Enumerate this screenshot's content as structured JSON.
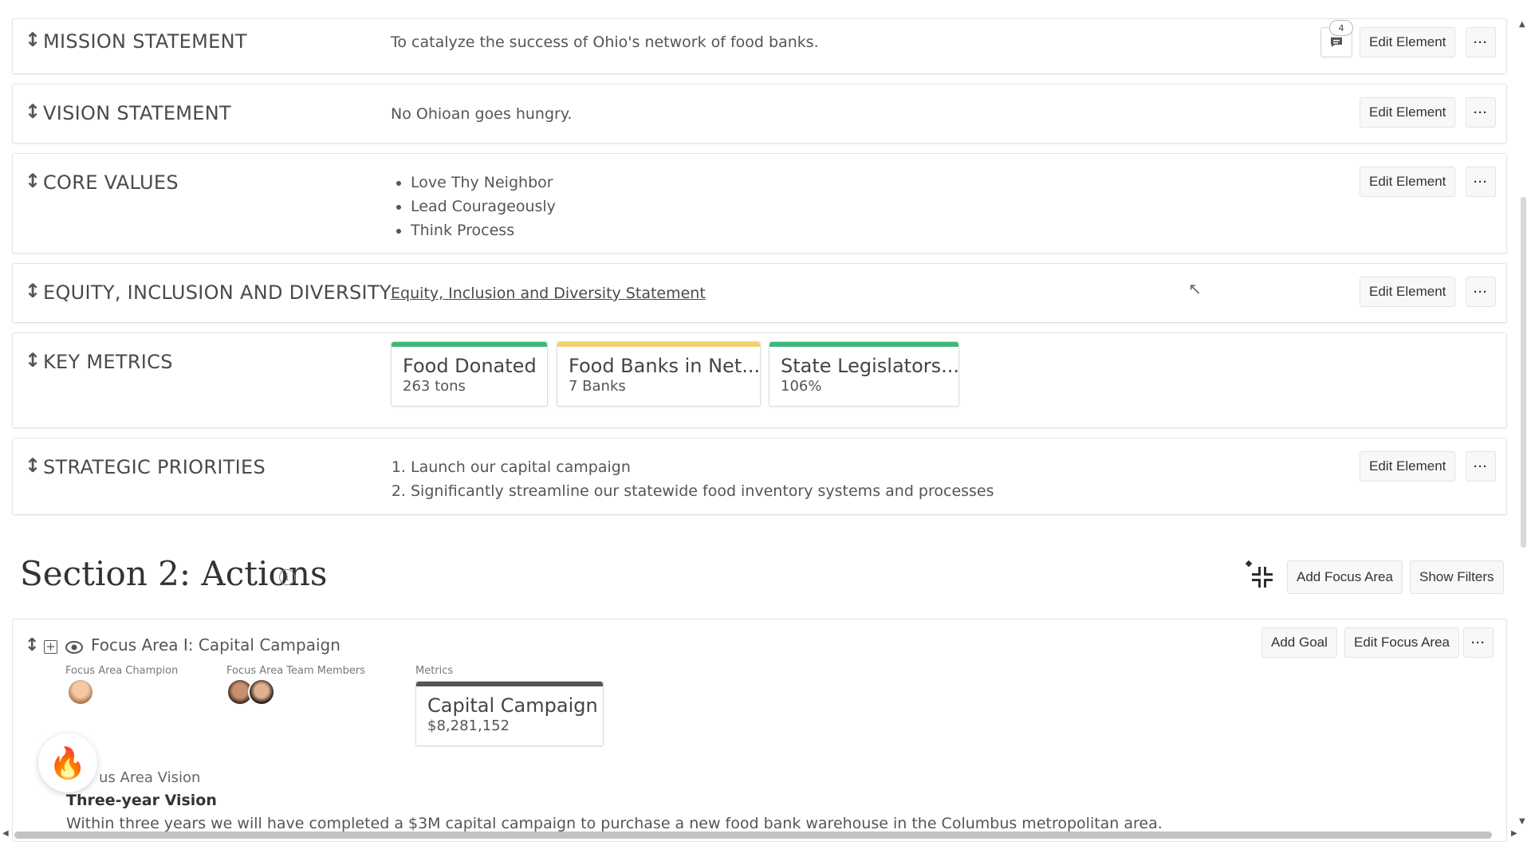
{
  "rows": {
    "mission": {
      "label": "MISSION STATEMENT",
      "text": "To catalyze the success of Ohio's network of food banks.",
      "comment_count": "4",
      "edit": "Edit Element"
    },
    "vision": {
      "label": "VISION STATEMENT",
      "text": "No Ohioan goes hungry.",
      "edit": "Edit Element"
    },
    "core_values": {
      "label": "CORE VALUES",
      "items": [
        "Love Thy Neighbor",
        "Lead Courageously",
        "Think Process"
      ],
      "edit": "Edit Element"
    },
    "eid": {
      "label": "EQUITY, INCLUSION AND DIVERSITY",
      "link": "Equity, Inclusion and Diversity Statement",
      "edit": "Edit Element"
    },
    "key_metrics": {
      "label": "KEY METRICS",
      "cards": [
        {
          "name": "Food Donated",
          "value": "263 tons",
          "color": "#3db87a"
        },
        {
          "name": "Food Banks in Net...",
          "value": "7 Banks",
          "color": "#f2d16b"
        },
        {
          "name": "State Legislators...",
          "value": "106%",
          "color": "#3db87a"
        }
      ]
    },
    "priorities": {
      "label": "STRATEGIC PRIORITIES",
      "items": [
        "Launch our capital campaign",
        "Significantly streamline our statewide food inventory systems and processes"
      ],
      "edit": "Edit Element"
    }
  },
  "more_label": "···",
  "section2": {
    "title": "Section 2: Actions",
    "info": "i",
    "add_focus_area": "Add Focus Area",
    "show_filters": "Show Filters"
  },
  "focus_area": {
    "title": "Focus Area I: Capital Campaign",
    "add_goal": "Add Goal",
    "edit_focus_area": "Edit Focus Area",
    "champion_label": "Focus Area Champion",
    "team_label": "Focus Area Team Members",
    "metrics_label": "Metrics",
    "metric": {
      "name": "Capital Campaign",
      "value": "$8,281,152",
      "color": "#555555"
    },
    "vision_label": "us Area Vision",
    "vision_title": "Three-year Vision",
    "vision_text": "Within three years we will have completed a $3M capital campaign to purchase a new food bank warehouse in the Columbus metropolitan area."
  }
}
